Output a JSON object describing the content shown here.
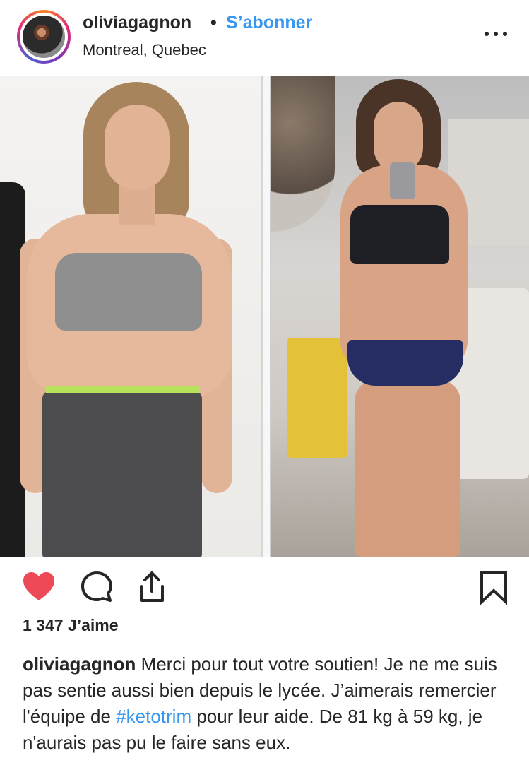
{
  "header": {
    "username": "oliviagagnon",
    "separator": "•",
    "follow_label": "S’abonner",
    "location": "Montreal, Quebec"
  },
  "actions": {
    "liked": true,
    "like_color": "#ed4956",
    "icons": [
      "heart-icon",
      "comment-icon",
      "share-icon",
      "bookmark-icon"
    ]
  },
  "likes": "1 347 J’aime",
  "caption": {
    "username": "oliviagagnon",
    "text_before": " Merci pour tout votre soutien! Je ne me suis pas sentie aussi bien depuis le lycée. J’aimerais remercier l'équipe de ",
    "hashtag": "#ketotrim",
    "text_after": " pour leur aide. De 81 kg à 59 kg, je n'aurais pas pu le faire sans eux."
  },
  "colors": {
    "link": "#3897f0",
    "text": "#262626"
  }
}
